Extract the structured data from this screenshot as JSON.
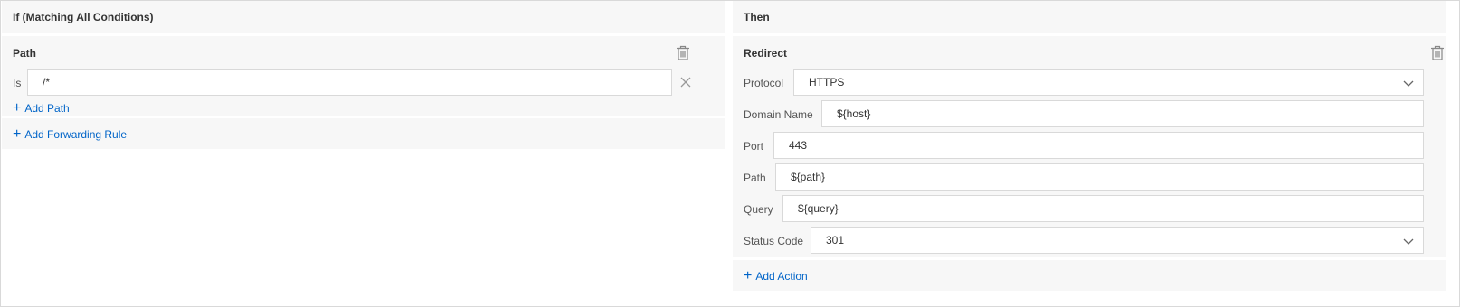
{
  "if_panel": {
    "header": "If (Matching All Conditions)",
    "condition": {
      "title": "Path",
      "operator": "Is",
      "value": "/*",
      "add_path_label": "Add Path"
    },
    "add_rule_label": "Add Forwarding Rule"
  },
  "then_panel": {
    "header": "Then",
    "action": {
      "title": "Redirect",
      "fields": {
        "protocol": {
          "label": "Protocol",
          "value": "HTTPS"
        },
        "domain": {
          "label": "Domain Name",
          "value": "${host}"
        },
        "port": {
          "label": "Port",
          "value": "443"
        },
        "path": {
          "label": "Path",
          "value": "${path}"
        },
        "query": {
          "label": "Query",
          "value": "${query}"
        },
        "status_code": {
          "label": "Status Code",
          "value": "301"
        }
      }
    },
    "add_action_label": "Add Action"
  },
  "icons": {
    "delete": "trash-icon",
    "clear": "close-icon",
    "dropdown": "chevron-down-icon",
    "add": "plus-icon"
  },
  "colors": {
    "link": "#0064c8",
    "panel_bg": "#f7f7f7",
    "border": "#d9d9d9"
  }
}
